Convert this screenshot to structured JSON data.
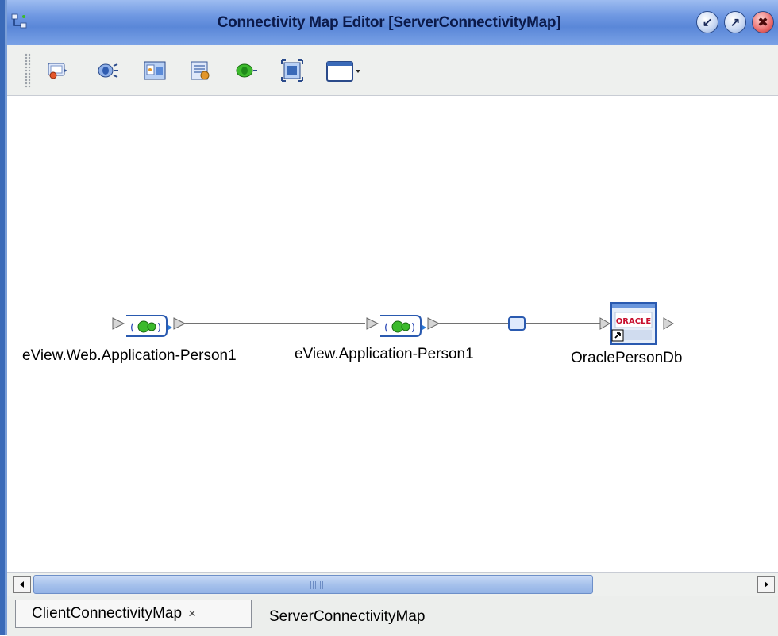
{
  "window": {
    "title": "Connectivity Map Editor [ServerConnectivityMap]"
  },
  "title_buttons": [
    {
      "name": "minimize",
      "glyph": "↙"
    },
    {
      "name": "maximize",
      "glyph": "↗"
    },
    {
      "name": "close",
      "glyph": "✖"
    }
  ],
  "toolbar": {
    "tools": [
      "external-application-icon",
      "service-icon",
      "web-service-icon",
      "collaboration-icon",
      "topic-icon",
      "select-all-icon",
      "window-dropdown-icon"
    ]
  },
  "canvas": {
    "nodes": [
      {
        "id": "web-app",
        "label": "eView.Web.Application-Person1"
      },
      {
        "id": "app",
        "label": "eView.Application-Person1"
      },
      {
        "id": "oracle",
        "label": "OraclePersonDb",
        "logo_text": "ORACLE"
      }
    ]
  },
  "tabs": [
    {
      "label": "ClientConnectivityMap",
      "close": "×",
      "active": true
    },
    {
      "label": "ServerConnectivityMap",
      "active": false
    }
  ],
  "colors": {
    "title_gradient_mid": "#6f98e2",
    "accent_blue": "#3a6ab8",
    "gear_green": "#3cba2c",
    "oracle_red": "#c8102e"
  }
}
